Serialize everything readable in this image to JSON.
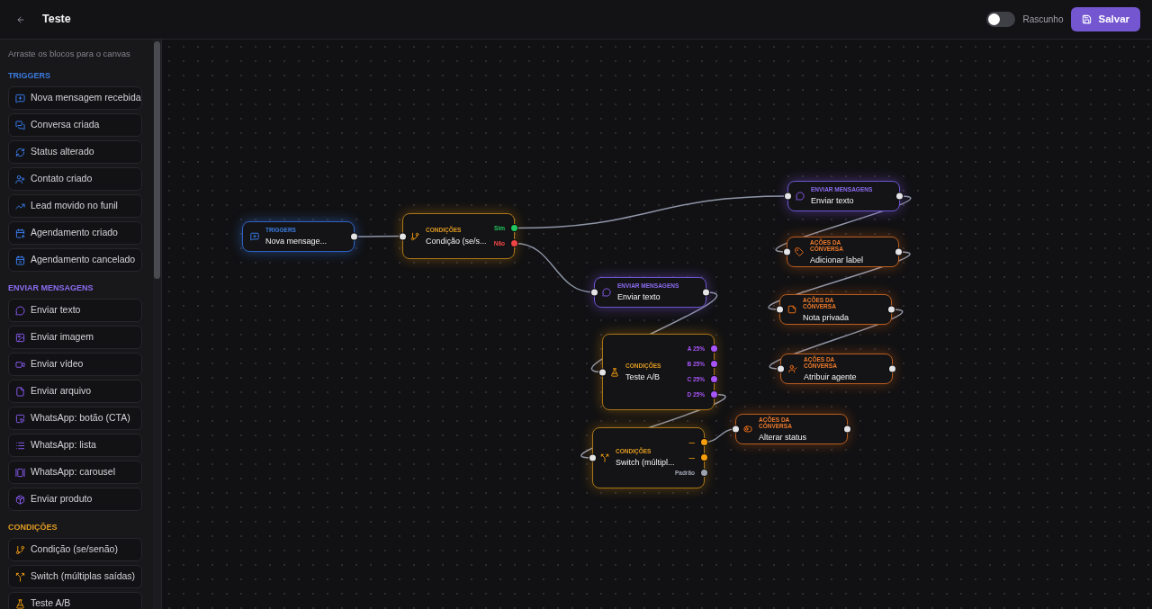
{
  "header": {
    "title": "Teste",
    "draft_switch": {
      "label": "Rascunho",
      "on": false
    },
    "save_button": "Salvar"
  },
  "sidebar": {
    "hint": "Arraste os blocos para o canvas",
    "sections": [
      {
        "kind": "trigger",
        "title": "TRIGGERS",
        "items": [
          "Nova mensagem recebida",
          "Conversa criada",
          "Status alterado",
          "Contato criado",
          "Lead movido no funil",
          "Agendamento criado",
          "Agendamento cancelado"
        ]
      },
      {
        "kind": "message",
        "title": "ENVIAR MENSAGENS",
        "items": [
          "Enviar texto",
          "Enviar imagem",
          "Enviar vídeo",
          "Enviar arquivo",
          "WhatsApp: botão (CTA)",
          "WhatsApp: lista",
          "WhatsApp: carousel",
          "Enviar produto"
        ]
      },
      {
        "kind": "condition",
        "title": "CONDIÇÕES",
        "items": [
          "Condição (se/senão)",
          "Switch (múltiplas saídas)",
          "Teste A/B"
        ]
      }
    ]
  },
  "canvas": {
    "nodes": [
      {
        "kind": "trigger",
        "category": "TRIGGERS",
        "title": "Nova mensage..."
      },
      {
        "kind": "condition",
        "category": "CONDIÇÕES",
        "title": "Condição (se/s...",
        "outputs": [
          {
            "label": "Sim",
            "color": "#22c55e"
          },
          {
            "label": "Não",
            "color": "#ef4444"
          }
        ]
      },
      {
        "kind": "message",
        "category": "ENVIAR MENSAGENS",
        "title": "Enviar texto"
      },
      {
        "kind": "action",
        "category": "AÇÕES DA CONVERSA",
        "title": "Adicionar label"
      },
      {
        "kind": "action",
        "category": "AÇÕES DA CONVERSA",
        "title": "Nota privada"
      },
      {
        "kind": "action",
        "category": "AÇÕES DA CONVERSA",
        "title": "Atribuir agente"
      },
      {
        "kind": "message",
        "category": "ENVIAR MENSAGENS",
        "title": "Enviar texto"
      },
      {
        "kind": "condition",
        "category": "CONDIÇÕES",
        "title": "Teste A/B",
        "outputs": [
          {
            "label": "A 25%",
            "color": "#a855f7"
          },
          {
            "label": "B 25%",
            "color": "#a855f7"
          },
          {
            "label": "C 25%",
            "color": "#a855f7"
          },
          {
            "label": "D 25%",
            "color": "#a855f7"
          }
        ]
      },
      {
        "kind": "condition",
        "category": "CONDIÇÕES",
        "title": "Switch (múltipl...",
        "outputs": [
          {
            "label": "—",
            "color": "#f59e0b"
          },
          {
            "label": "—",
            "color": "#f59e0b"
          },
          {
            "label": "Padrão",
            "color": "#9ca3af"
          }
        ]
      },
      {
        "kind": "action",
        "category": "AÇÕES DA CONVERSA",
        "title": "Alterar status"
      }
    ]
  }
}
